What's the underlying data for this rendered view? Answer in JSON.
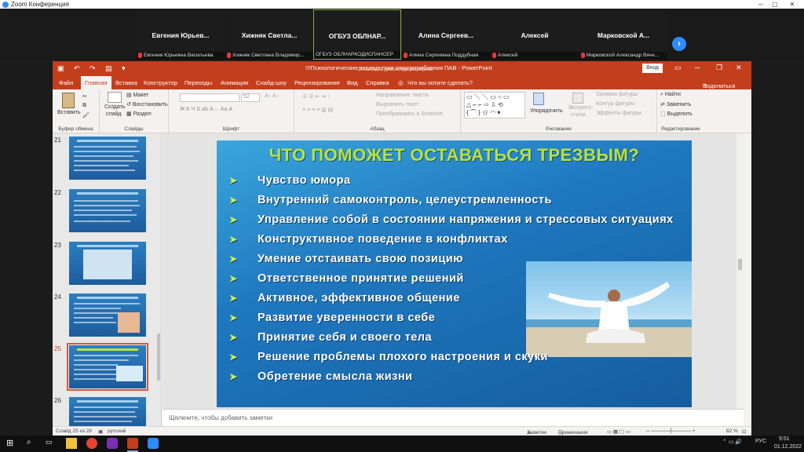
{
  "zoom": {
    "window_title": "Zoom Конференция",
    "participants": [
      {
        "display": "Евгения Юрьев...",
        "label": "Евгения Юрьевна Васильева",
        "muted": true
      },
      {
        "display": "Хижняк Светла...",
        "label": "Хижняк Светлана Владимир...",
        "muted": true
      },
      {
        "display": "ОГБУЗ ОБЛНАР...",
        "label": "ОГБУЗ ОБЛНАРКОДИСПАНСЕР",
        "muted": false,
        "active": true
      },
      {
        "display": "Алина Сергеев...",
        "label": "Алина Сергеевна Поддубная",
        "muted": true
      },
      {
        "display": "Алексей",
        "label": "Алексей",
        "muted": true
      },
      {
        "display": "Марковской А...",
        "label": "Марковской Александр Вяче...",
        "muted": true
      }
    ],
    "next_icon": "chevron-right-icon"
  },
  "ppt": {
    "doc_title": "!!!Психологические последствия злоупотребления ПАВ - PowerPoint",
    "doc_overlay": "Остановить демонстрацию экрана",
    "signin": "Вход",
    "tabs": [
      "Файл",
      "Главная",
      "Вставка",
      "Конструктор",
      "Переходы",
      "Анимация",
      "Слайд-шоу",
      "Рецензирование",
      "Вид",
      "Справка"
    ],
    "tellme": "Что вы хотите сделать?",
    "share": "Поделиться",
    "ribbon": {
      "paste": "Вставить",
      "clipboard": "Буфер обмена",
      "create_slide_1": "Создать",
      "create_slide_2": "слайд",
      "layout": "Макет",
      "reset": "Восстановить",
      "section": "Раздел",
      "slides_group": "Слайды",
      "font_group": "Шрифт",
      "font_size": "52",
      "paragraph_group": "Абзац",
      "text_direction": "Направление текста",
      "align_text": "Выровнять текст",
      "convert_smartart": "Преобразовать в SmartArt",
      "drawing_group": "Рисование",
      "arrange": "Упорядочить",
      "express_styles_1": "Экспресс-",
      "express_styles_2": "стили",
      "shape_fill": "Заливка фигуры",
      "shape_outline": "Контур фигуры",
      "shape_effects": "Эффекты фигуры",
      "find": "Найти",
      "replace": "Заменить",
      "select": "Выделить",
      "editing_group": "Редактирование"
    },
    "thumbnails": [
      {
        "num": "21",
        "selected": false
      },
      {
        "num": "22",
        "selected": false
      },
      {
        "num": "23",
        "selected": false
      },
      {
        "num": "24",
        "selected": false
      },
      {
        "num": "25",
        "selected": true
      },
      {
        "num": "26",
        "selected": false
      }
    ],
    "slide": {
      "title": "ЧТО ПОМОЖЕТ ОСТАВАТЬСЯ ТРЕЗВЫМ?",
      "bullets": [
        "Чувство юмора",
        "Внутренний самоконтроль, целеустремленность",
        "Управление собой в состоянии напряжения и стрессовых ситуациях",
        "Конструктивное поведение в конфликтах",
        "Умение отстаивать свою позицию",
        "Ответственное принятие решений",
        "Активное, эффективное общение",
        "Развитие уверенности в себе",
        "Принятие себя и своего тела",
        "Решение проблемы плохого настроения и скуки",
        "Обретение смысла жизни"
      ],
      "bullet_icon": "arrow-bullet-icon",
      "title_color": "#b9e23c"
    },
    "notes_placeholder": "Щелкните, чтобы добавить заметки",
    "status": {
      "slide_counter": "Слайд 25 из 28",
      "language": "русский",
      "notes": "Заметки",
      "comments": "Примечания",
      "zoom": "82 %"
    }
  },
  "taskbar": {
    "lang": "РУС",
    "time": "9:51",
    "date": "01.12.2022"
  }
}
